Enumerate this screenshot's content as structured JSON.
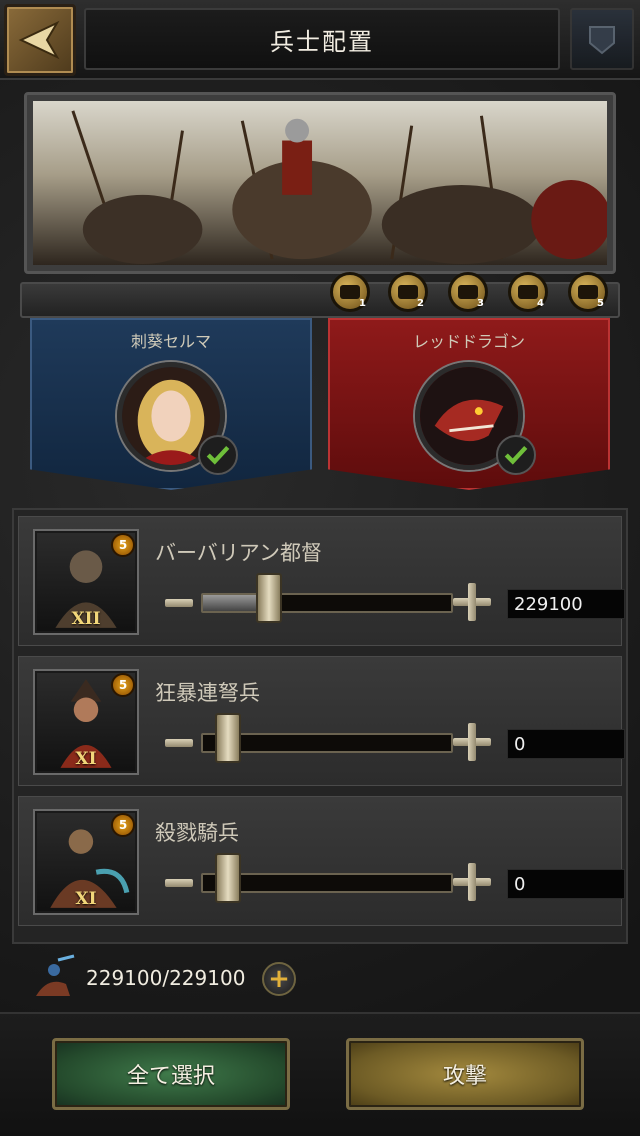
{
  "header": {
    "title": "兵士配置"
  },
  "medals": [
    {
      "number": "1"
    },
    {
      "number": "2"
    },
    {
      "number": "3"
    },
    {
      "number": "4"
    },
    {
      "number": "5"
    }
  ],
  "commanders": [
    {
      "name": "刺葵セルマ",
      "color": "#1f3a5a",
      "selected": true
    },
    {
      "name": "レッドドラゴン",
      "color": "#8f1a1a",
      "selected": true
    }
  ],
  "troops": [
    {
      "name": "バーバリアン都督",
      "tier": "XII",
      "level": "5",
      "value": "229100",
      "fraction": 0.27
    },
    {
      "name": "狂暴連弩兵",
      "tier": "XI",
      "level": "5",
      "value": "0",
      "fraction": 0.0
    },
    {
      "name": "殺戮騎兵",
      "tier": "XI",
      "level": "5",
      "value": "0",
      "fraction": 0.0
    }
  ],
  "summary": {
    "count": "229100/229100"
  },
  "buttons": {
    "select_all": "全て選択",
    "attack": "攻撃"
  },
  "colors": {
    "accent_gold": "#e2b13a",
    "button_green": "#3f7a4a",
    "button_gold": "#a48a3e"
  }
}
